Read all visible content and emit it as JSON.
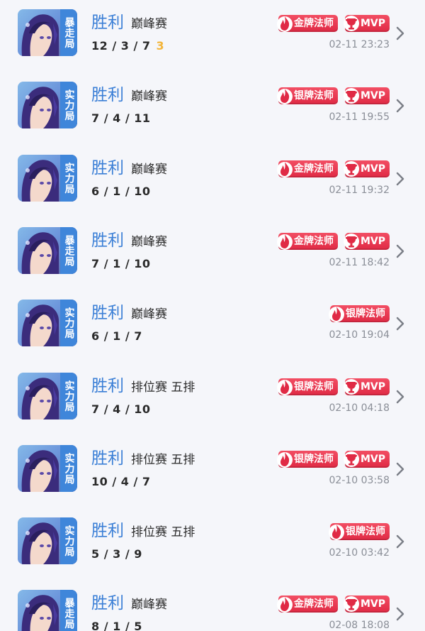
{
  "records": [
    {
      "mode": "暴走局",
      "result": "胜利",
      "match_type": "巅峰赛",
      "kda": "12/3/7",
      "extra": "3",
      "badges": [
        "金牌法师",
        "MVP"
      ],
      "time": "02-11 23:23"
    },
    {
      "mode": "实力局",
      "result": "胜利",
      "match_type": "巅峰赛",
      "kda": "7/4/11",
      "extra": "",
      "badges": [
        "银牌法师",
        "MVP"
      ],
      "time": "02-11 19:55"
    },
    {
      "mode": "实力局",
      "result": "胜利",
      "match_type": "巅峰赛",
      "kda": "6/1/10",
      "extra": "",
      "badges": [
        "金牌法师",
        "MVP"
      ],
      "time": "02-11 19:32"
    },
    {
      "mode": "暴走局",
      "result": "胜利",
      "match_type": "巅峰赛",
      "kda": "7/1/10",
      "extra": "",
      "badges": [
        "金牌法师",
        "MVP"
      ],
      "time": "02-11 18:42"
    },
    {
      "mode": "实力局",
      "result": "胜利",
      "match_type": "巅峰赛",
      "kda": "6/1/7",
      "extra": "",
      "badges": [
        "银牌法师"
      ],
      "time": "02-10 19:04"
    },
    {
      "mode": "实力局",
      "result": "胜利",
      "match_type": "排位赛 五排",
      "kda": "7/4/10",
      "extra": "",
      "badges": [
        "银牌法师",
        "MVP"
      ],
      "time": "02-10 04:18"
    },
    {
      "mode": "实力局",
      "result": "胜利",
      "match_type": "排位赛 五排",
      "kda": "10/4/7",
      "extra": "",
      "badges": [
        "银牌法师",
        "MVP"
      ],
      "time": "02-10 03:58"
    },
    {
      "mode": "实力局",
      "result": "胜利",
      "match_type": "排位赛 五排",
      "kda": "5/3/9",
      "extra": "",
      "badges": [
        "银牌法师"
      ],
      "time": "02-10 03:42"
    },
    {
      "mode": "暴走局",
      "result": "胜利",
      "match_type": "巅峰赛",
      "kda": "8/1/5",
      "extra": "",
      "badges": [
        "金牌法师",
        "MVP"
      ],
      "time": "02-08 18:08"
    }
  ],
  "colors": {
    "win": "#3b7fd6",
    "mode_tag": "#3f86da",
    "badge": "#e02a45",
    "extra": "#f3b53a",
    "time": "#8a8e97"
  },
  "icons": {
    "avatar": "hero-portrait-icon",
    "badge": "flame-icon",
    "mvp": "trophy-icon",
    "chevron": "chevron-right-icon"
  }
}
